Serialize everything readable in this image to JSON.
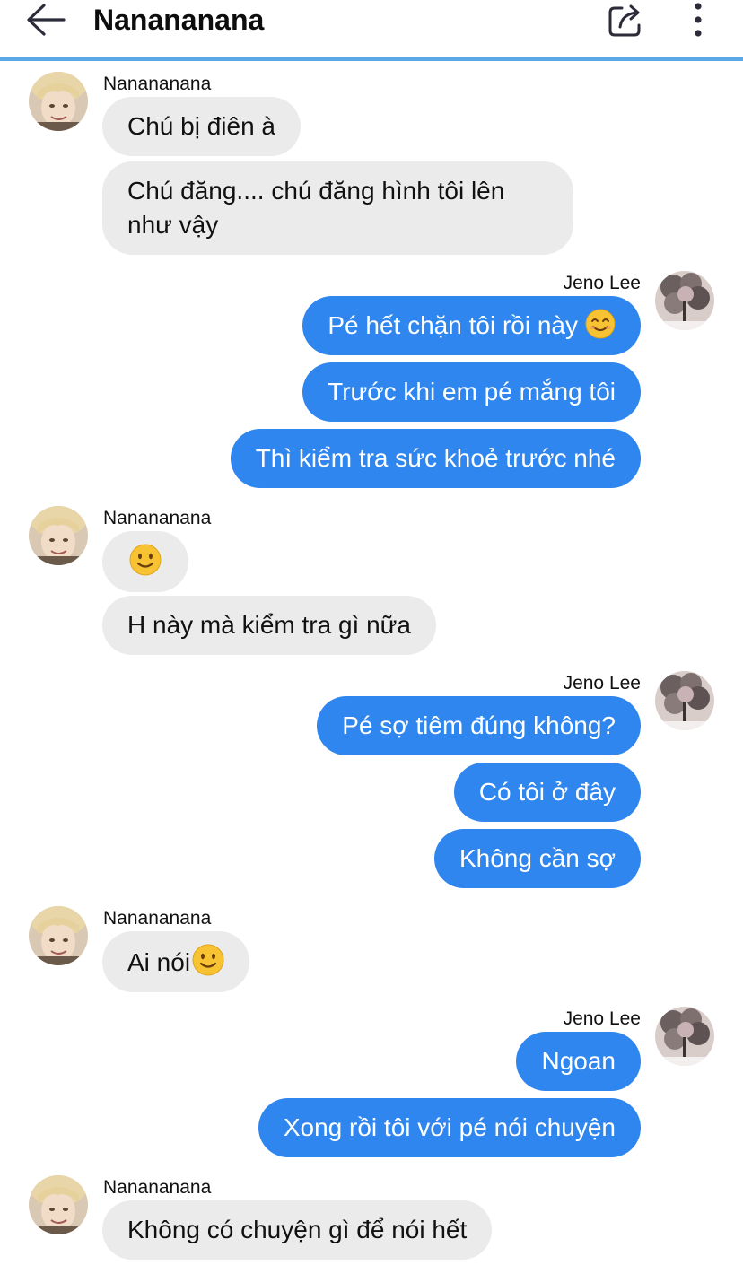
{
  "header": {
    "title": "Nanananana",
    "back_icon": "arrow-left-icon",
    "share_icon": "share-icon",
    "more_icon": "more-vertical-icon",
    "accent": "#5aa9e6"
  },
  "colors": {
    "incoming_bubble": "#ebebeb",
    "outgoing_bubble": "#2f86ee"
  },
  "messages": {
    "g1": {
      "sender": "Nanananana",
      "m1": "Chú bị điên à",
      "m2": "Chú đăng.... chú đăng hình tôi lên như vậy"
    },
    "g2": {
      "sender": "Jeno Lee",
      "m1": "Pé hết chặn tôi rồi này",
      "m2": "Trước khi em pé mắng tôi",
      "m3": "Thì kiểm tra sức khoẻ trước nhé"
    },
    "g3": {
      "sender": "Nanananana",
      "m2": "H này mà kiểm tra gì nữa"
    },
    "g4": {
      "sender": "Jeno Lee",
      "m1": "Pé sợ tiêm đúng không?",
      "m2": "Có tôi ở đây",
      "m3": "Không cần sợ"
    },
    "g5": {
      "sender": "Nanananana",
      "m1": "Ai nói"
    },
    "g6": {
      "sender": "Jeno Lee",
      "m1": "Ngoan",
      "m2": "Xong rồi tôi với pé nói chuyện"
    },
    "g7": {
      "sender": "Nanananana",
      "m1": "Không có chuyện gì để nói hết"
    }
  }
}
